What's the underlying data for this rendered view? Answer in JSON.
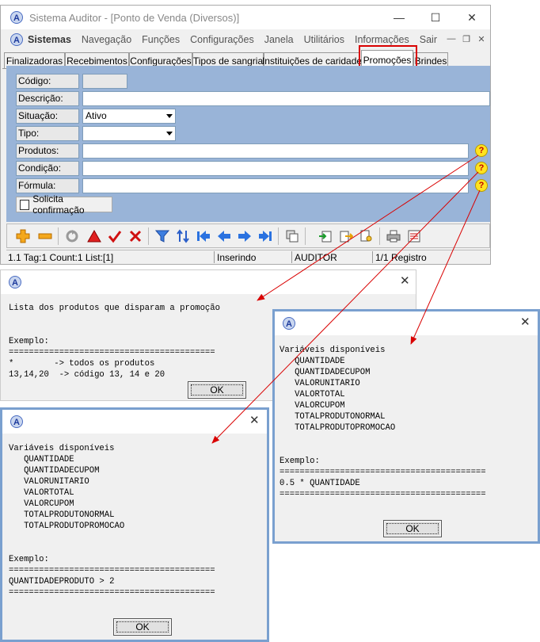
{
  "main_window": {
    "title": "Sistema Auditor - [Ponto de Venda (Diversos)]",
    "minimize_glyph": "—",
    "maximize_glyph": "☐",
    "close_glyph": "✕",
    "menu": [
      "Sistemas",
      "Navegação",
      "Funções",
      "Configurações",
      "Janela",
      "Utilitários",
      "Informações",
      "Sair"
    ],
    "mdi_controls": [
      "—",
      "❐",
      "✕"
    ],
    "tabs": [
      "Finalizadoras",
      "Recebimentos",
      "Configurações",
      "Tipos de sangria",
      "Instituições de caridade",
      "Promoções",
      "Brindes"
    ],
    "active_tab": "Promoções",
    "form": {
      "codigo_label": "Código:",
      "descricao_label": "Descrição:",
      "situacao_label": "Situação:",
      "situacao_value": "Ativo",
      "tipo_label": "Tipo:",
      "produtos_label": "Produtos:",
      "condicao_label": "Condição:",
      "formula_label": "Fórmula:",
      "help_glyph": "?",
      "solicita_label": "Solicita confirmação"
    },
    "status": {
      "info": "1.1 Tag:1 Count:1 List:[1]",
      "mode": "Inserindo",
      "user": "AUDITOR",
      "record": "1/1 Registro"
    }
  },
  "dialog_products": {
    "close_glyph": "✕",
    "text": "Lista dos produtos que disparam a promoção\n\n\nExemplo:\n=========================================\n*        -> todos os produtos\n13,14,20  -> código 13, 14 e 20",
    "ok_label": "OK"
  },
  "dialog_formula": {
    "close_glyph": "✕",
    "text": "Variáveis disponíveis\n   QUANTIDADE\n   QUANTIDADECUPOM\n   VALORUNITARIO\n   VALORTOTAL\n   VALORCUPOM\n   TOTALPRODUTONORMAL\n   TOTALPRODUTOPROMOCAO\n\n\nExemplo:\n=========================================\n0.5 * QUANTIDADE\n=========================================",
    "ok_label": "OK"
  },
  "dialog_condition": {
    "close_glyph": "✕",
    "text": "Variáveis disponíveis\n   QUANTIDADE\n   QUANTIDADECUPOM\n   VALORUNITARIO\n   VALORTOTAL\n   VALORCUPOM\n   TOTALPRODUTONORMAL\n   TOTALPRODUTOPROMOCAO\n\n\nExemplo:\n=========================================\nQUANTIDADEPRODUTO > 2\n=========================================",
    "ok_label": "OK"
  },
  "colors": {
    "panel": "#99b4d8",
    "highlight": "#d90000",
    "arrow": "#d90000"
  }
}
